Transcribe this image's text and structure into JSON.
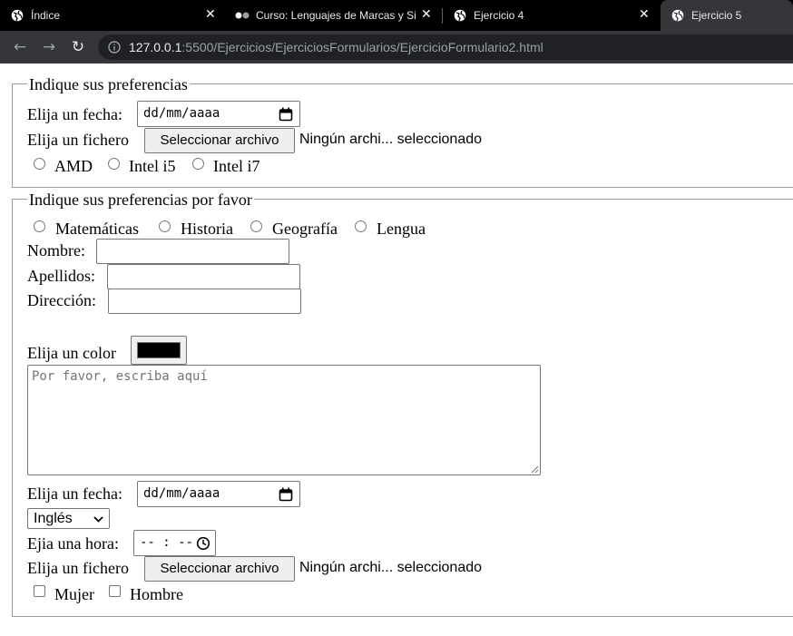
{
  "browser": {
    "tabs": [
      {
        "title": "Índice",
        "icon": "globe-icon",
        "active": false
      },
      {
        "title": "Curso: Lenguajes de Marcas y Sis",
        "icon": "loading-dots-icon",
        "active": false
      },
      {
        "title": "Ejercicio 4",
        "icon": "globe-icon",
        "active": false
      },
      {
        "title": "Ejercicio 5",
        "icon": "globe-icon",
        "active": true
      }
    ],
    "url_host": "127.0.0.1",
    "url_path": ":5500/Ejercicios/EjerciciosFormularios/EjercicioFormulario2.html"
  },
  "section1": {
    "legend": "Indique sus preferencias",
    "date_label": "Elija un fecha:",
    "date_value": "dd/mm/aaaa",
    "file_label": "Elija un fichero",
    "file_button": "Seleccionar archivo",
    "file_status": "Ningún archi... seleccionado",
    "radios": [
      "AMD",
      "Intel i5",
      "Intel i7"
    ]
  },
  "section2": {
    "legend": "Indique sus preferencias por favor",
    "subjects": [
      "Matemáticas",
      "Historia",
      "Geografía",
      "Lengua"
    ],
    "name_label": "Nombre:",
    "surname_label": "Apellidos:",
    "address_label": "Dirección:",
    "color_label": "Elija un color",
    "color_value": "#000000",
    "textarea_placeholder": "Por favor, escriba aquí",
    "date_label": "Elija un fecha:",
    "date_value": "dd/mm/aaaa",
    "language_selected": "Inglés",
    "time_label": "Ejia una hora:",
    "time_value": "-- : --",
    "file_label": "Elija un fichero",
    "file_button": "Seleccionar archivo",
    "file_status": "Ningún archi... seleccionado",
    "genders": [
      "Mujer",
      "Hombre"
    ]
  }
}
